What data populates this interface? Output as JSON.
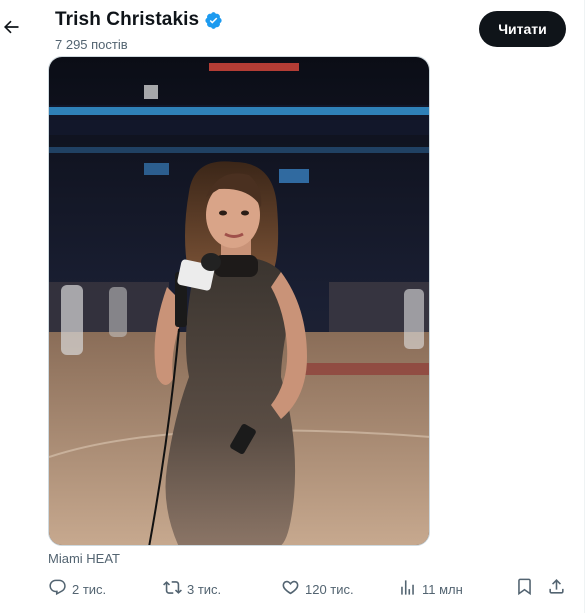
{
  "header": {
    "back_icon": "arrow-left-icon",
    "name": "Trish Christakis",
    "verified_icon": "verified-badge-icon",
    "verified_color": "#1d9bf0",
    "post_count": "7 295 постів",
    "follow_label": "Читати"
  },
  "post": {
    "media_caption": "Miami HEAT",
    "actions": {
      "replies": "2 тис.",
      "reposts": "3 тис.",
      "likes": "120 тис.",
      "views": "11 млн"
    },
    "icons": {
      "reply": "reply-icon",
      "repost": "repost-icon",
      "like": "heart-icon",
      "views": "views-chart-icon",
      "bookmark": "bookmark-icon",
      "share": "share-icon"
    }
  },
  "colors": {
    "text_primary": "#0f1419",
    "text_secondary": "#536471",
    "button_dark": "#0f1419",
    "accent": "#1d9bf0"
  }
}
